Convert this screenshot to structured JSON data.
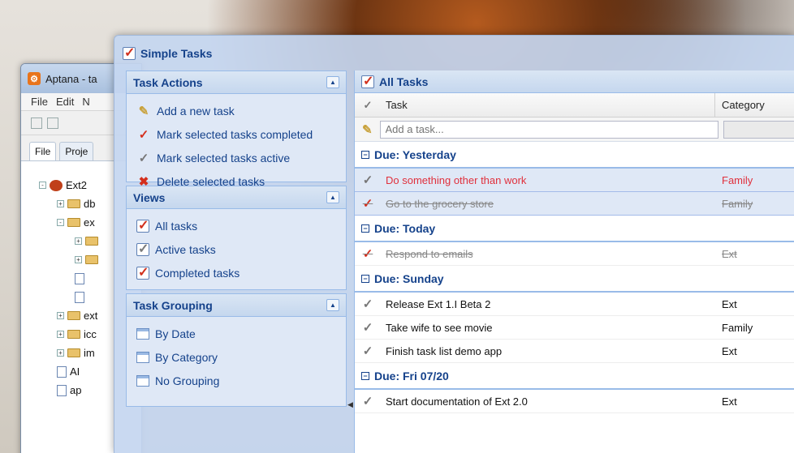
{
  "background_window": {
    "title": "Aptana - ta",
    "menu": [
      "File",
      "Edit",
      "N"
    ],
    "view_tabs": [
      "File",
      "Proje"
    ],
    "tree": [
      {
        "label": "Ext2",
        "type": "project",
        "expander": "-"
      },
      {
        "label": "db",
        "type": "folder",
        "expander": "+"
      },
      {
        "label": "ex",
        "type": "folder",
        "expander": "-"
      },
      {
        "label": "",
        "type": "folder",
        "expander": "+"
      },
      {
        "label": "",
        "type": "folder",
        "expander": "+"
      },
      {
        "label": "",
        "type": "file",
        "expander": ""
      },
      {
        "label": "",
        "type": "file",
        "expander": ""
      },
      {
        "label": "ext",
        "type": "folder",
        "expander": "+"
      },
      {
        "label": "icc",
        "type": "folder",
        "expander": "+"
      },
      {
        "label": "im",
        "type": "folder",
        "expander": "+"
      },
      {
        "label": "AI",
        "type": "file",
        "expander": ""
      },
      {
        "label": "ap",
        "type": "file",
        "expander": ""
      }
    ]
  },
  "window": {
    "title": "Simple Tasks"
  },
  "sidebar": {
    "task_actions": {
      "title": "Task Actions",
      "items": [
        {
          "label": "Add a new task",
          "icon": "add-task-icon"
        },
        {
          "label": "Mark selected tasks completed",
          "icon": "checkmark-icon"
        },
        {
          "label": "Mark selected tasks active",
          "icon": "clock-check-icon"
        },
        {
          "label": "Delete selected tasks",
          "icon": "delete-x-icon"
        }
      ]
    },
    "views": {
      "title": "Views",
      "items": [
        {
          "label": "All tasks"
        },
        {
          "label": "Active tasks"
        },
        {
          "label": "Completed tasks"
        }
      ]
    },
    "grouping": {
      "title": "Task Grouping",
      "items": [
        {
          "label": "By Date"
        },
        {
          "label": "By Category"
        },
        {
          "label": "No Grouping"
        }
      ]
    }
  },
  "grid": {
    "title": "All Tasks",
    "columns": {
      "check": "✓",
      "task": "Task",
      "category": "Category"
    },
    "add_placeholder": "Add a task...",
    "groups": [
      {
        "title": "Due: Yesterday",
        "rows": [
          {
            "task": "Do something other than work",
            "category": "Family",
            "status": "overdue",
            "selected": true
          },
          {
            "task": "Go to the grocery store",
            "category": "Family",
            "status": "done",
            "selected": true
          }
        ]
      },
      {
        "title": "Due: Today",
        "rows": [
          {
            "task": "Respond to emails",
            "category": "Ext",
            "status": "done",
            "selected": false
          }
        ]
      },
      {
        "title": "Due: Sunday",
        "rows": [
          {
            "task": "Release Ext 1.I Beta 2",
            "category": "Ext",
            "status": "active",
            "selected": false
          },
          {
            "task": "Take wife to see movie",
            "category": "Family",
            "status": "active",
            "selected": false
          },
          {
            "task": "Finish task list demo app",
            "category": "Ext",
            "status": "active",
            "selected": false
          }
        ]
      },
      {
        "title": "Due: Fri 07/20",
        "rows": [
          {
            "task": "Start documentation of Ext 2.0",
            "category": "Ext",
            "status": "active",
            "selected": false
          }
        ]
      }
    ]
  },
  "colors": {
    "header_blue": "#15428b",
    "overdue_red": "#e0303c",
    "done_grey": "#888888",
    "selection": "#dfe8f6"
  }
}
